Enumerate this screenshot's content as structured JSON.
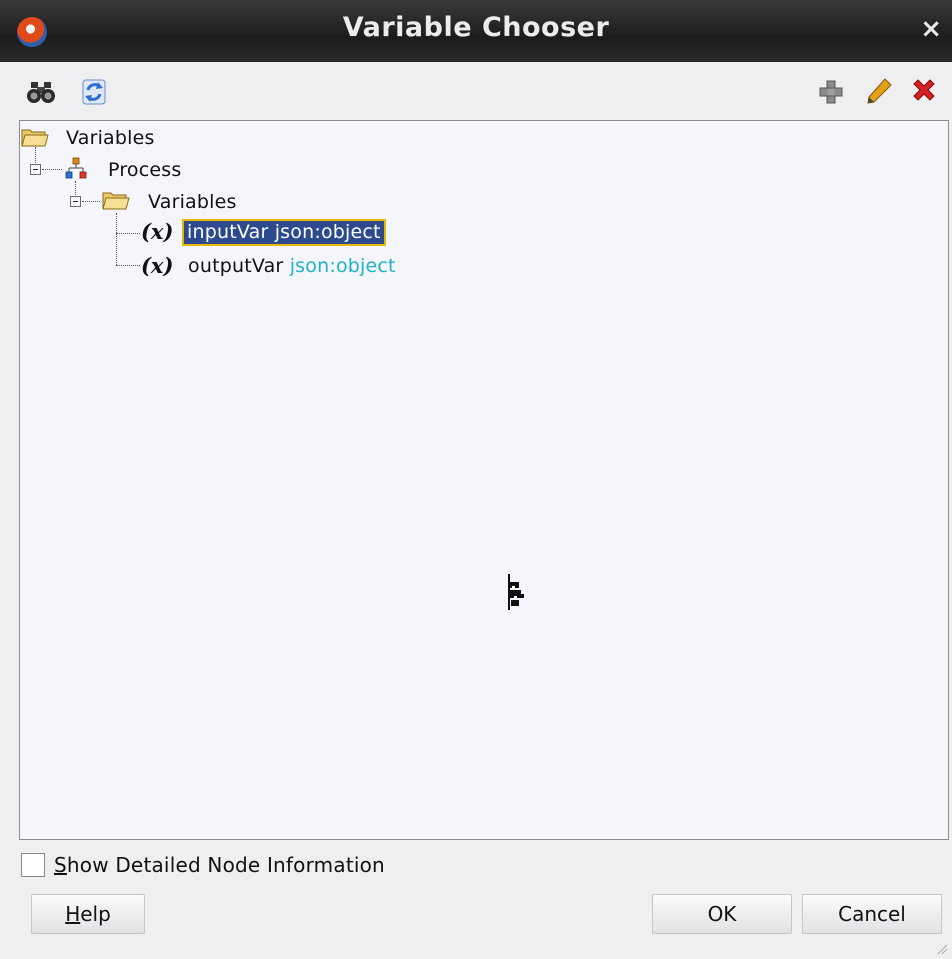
{
  "window": {
    "title": "Variable Chooser",
    "close_glyph": "×"
  },
  "toolbar": {
    "left_icons": [
      "binoculars-icon",
      "refresh-icon"
    ],
    "right_icons": [
      "add-icon",
      "edit-icon",
      "delete-icon"
    ]
  },
  "tree": {
    "root": {
      "label": "Variables",
      "icon": "folder-icon"
    },
    "process": {
      "label": "Process",
      "icon": "process-icon"
    },
    "variables_folder": {
      "label": "Variables",
      "icon": "folder-icon"
    },
    "variables": [
      {
        "name": "inputVar",
        "type": "json:object",
        "icon": "variable-x-icon",
        "selected": true
      },
      {
        "name": "outputVar",
        "type": "json:object",
        "icon": "variable-x-icon",
        "selected": false
      }
    ]
  },
  "footer": {
    "checkbox_prefix": "S",
    "checkbox_rest": "how Detailed Node Information",
    "checkbox_checked": false,
    "help_prefix": "H",
    "help_rest": "elp",
    "ok_label": "OK",
    "cancel_label": "Cancel"
  },
  "colors": {
    "selection_bg": "#2c4a8d",
    "selection_border": "#e6b800",
    "type_text": "#1fb2c6"
  }
}
